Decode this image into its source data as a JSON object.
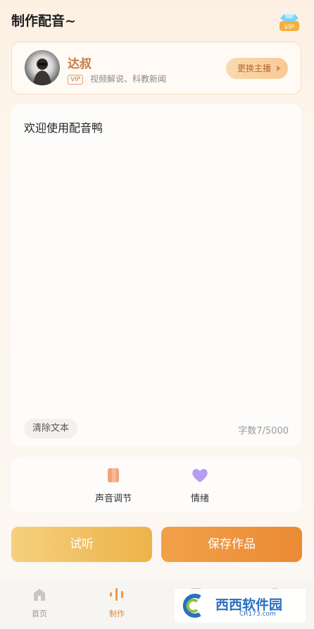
{
  "header": {
    "title": "制作配音~",
    "vip_icon": "diamond-vip-icon",
    "vip_text": "VIP"
  },
  "anchor": {
    "name": "达叔",
    "vip_badge": "VIP",
    "description": "视频解说、科教新闻",
    "switch_label": "更换主播"
  },
  "editor": {
    "text": "欢迎使用配音鸭",
    "clear_label": "清除文本",
    "char_count": "字数7/5000"
  },
  "tools": [
    {
      "label": "声音调节",
      "icon": "voice-adjust-icon",
      "color": "#f2a27c"
    },
    {
      "label": "情绪",
      "icon": "heart-icon",
      "color": "#b79cf2"
    }
  ],
  "actions": {
    "listen_label": "试听",
    "save_label": "保存作品"
  },
  "tabbar": [
    {
      "label": "首页",
      "icon": "home-icon"
    },
    {
      "label": "制作",
      "icon": "waveform-icon",
      "active": true
    },
    {
      "label": "",
      "icon": "works-icon"
    },
    {
      "label": "",
      "icon": "profile-icon"
    }
  ],
  "watermark": {
    "text": "西西软件园",
    "sub": "CR173.com"
  },
  "colors": {
    "accent": "#eb8a34",
    "brand_text": "#c77a3f"
  }
}
